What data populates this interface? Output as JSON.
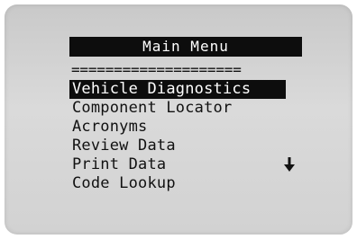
{
  "title": "Main Menu",
  "separator": "====================",
  "menu": {
    "items": [
      {
        "label": "Vehicle Diagnostics",
        "selected": true
      },
      {
        "label": "Component Locator",
        "selected": false
      },
      {
        "label": "Acronyms",
        "selected": false
      },
      {
        "label": "Review Data",
        "selected": false
      },
      {
        "label": "Print Data",
        "selected": false
      },
      {
        "label": "Code Lookup",
        "selected": false
      }
    ]
  },
  "scroll_indicator": "arrow-down-icon"
}
